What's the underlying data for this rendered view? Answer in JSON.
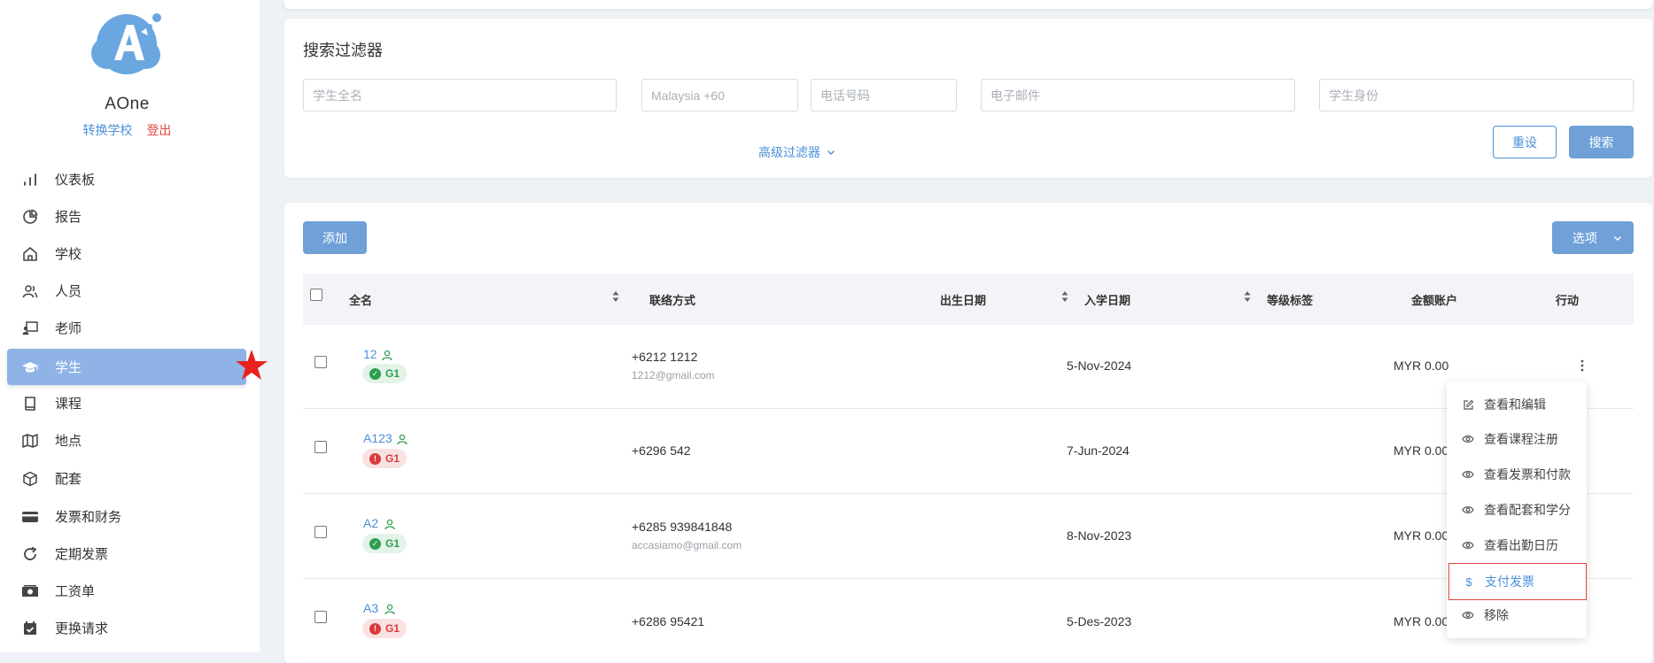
{
  "brand": {
    "name": "AOne",
    "switch_school": "转换学校",
    "logout": "登出"
  },
  "sidebar": {
    "items": [
      {
        "label": "仪表板",
        "icon": "bar-chart-icon"
      },
      {
        "label": "报告",
        "icon": "pie-chart-icon"
      },
      {
        "label": "学校",
        "icon": "home-icon"
      },
      {
        "label": "人员",
        "icon": "users-icon"
      },
      {
        "label": "老师",
        "icon": "teacher-icon"
      },
      {
        "label": "学生",
        "icon": "graduation-cap-icon",
        "active": true
      },
      {
        "label": "课程",
        "icon": "book-icon"
      },
      {
        "label": "地点",
        "icon": "map-icon"
      },
      {
        "label": "配套",
        "icon": "package-icon"
      },
      {
        "label": "发票和财务",
        "icon": "credit-card-icon"
      },
      {
        "label": "定期发票",
        "icon": "refresh-icon"
      },
      {
        "label": "工资单",
        "icon": "money-icon"
      },
      {
        "label": "更换请求",
        "icon": "calendar-check-icon"
      }
    ]
  },
  "filter": {
    "title": "搜索过滤器",
    "name_placeholder": "学生全名",
    "country_placeholder": "Malaysia +60",
    "phone_placeholder": "电话号码",
    "email_placeholder": "电子邮件",
    "id_placeholder": "学生身份",
    "advanced": "高级过滤器",
    "reset": "重设",
    "search": "搜索"
  },
  "list": {
    "add": "添加",
    "options": "选项",
    "columns": {
      "name": "全名",
      "contact": "联络方式",
      "dob": "出生日期",
      "enroll": "入学日期",
      "grade": "等级标签",
      "account": "金额账户",
      "action": "行动"
    },
    "rows": [
      {
        "name": "12",
        "badge": "G1",
        "status": "ok",
        "phone": "+6212  1212",
        "email": "1212@gmail.com",
        "enroll": "5-Nov-2024",
        "account": "MYR 0.00"
      },
      {
        "name": "A123",
        "badge": "G1",
        "status": "warn",
        "phone": "+6296  542",
        "email": "",
        "enroll": "7-Jun-2024",
        "account": "MYR 0.00"
      },
      {
        "name": "A2",
        "badge": "G1",
        "status": "ok",
        "phone": "+6285  939841848",
        "email": "accasiamo@gmail.com",
        "enroll": "8-Nov-2023",
        "account": "MYR 0.00"
      },
      {
        "name": "A3",
        "badge": "G1",
        "status": "warn",
        "phone": "+6286  95421",
        "email": "",
        "enroll": "5-Des-2023",
        "account": "MYR 0.00"
      }
    ]
  },
  "menu": {
    "items": [
      {
        "label": "查看和编辑",
        "icon": "edit-icon"
      },
      {
        "label": "查看课程注册",
        "icon": "eye-icon"
      },
      {
        "label": "查看发票和付款",
        "icon": "eye-icon"
      },
      {
        "label": "查看配套和学分",
        "icon": "eye-icon"
      },
      {
        "label": "查看出勤日历",
        "icon": "eye-icon"
      },
      {
        "label": "支付发票",
        "icon": "dollar-icon",
        "highlight": true
      },
      {
        "label": "移除",
        "icon": "eye-icon"
      }
    ]
  },
  "colors": {
    "accent": "#4a90d9",
    "active_nav": "#8fb3e6",
    "danger": "#e0463e",
    "success": "#2e9e4f"
  }
}
